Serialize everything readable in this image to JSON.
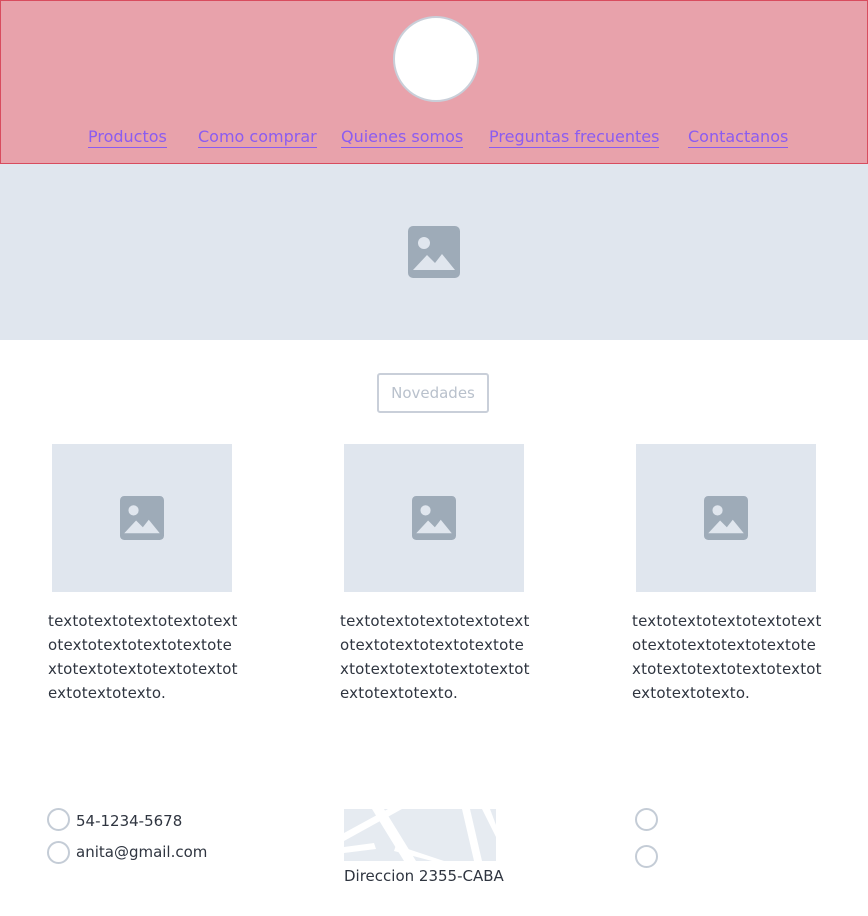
{
  "header": {
    "nav": [
      {
        "label": "Productos"
      },
      {
        "label": "Como comprar"
      },
      {
        "label": "Quienes somos"
      },
      {
        "label": "Preguntas frecuentes"
      },
      {
        "label": "Contactanos"
      }
    ]
  },
  "main": {
    "section_button": "Novedades",
    "cards": [
      {
        "text": "textotextotextotextotextotextotextotextotextotextotextotextotextotextotextotextotexto."
      },
      {
        "text": "textotextotextotextotextotextotextotextotextotextotextotextotextotextotextotextotexto."
      },
      {
        "text": "textotextotextotextotextotextotextotextotextotextotextotextotextotextotextotextotexto."
      }
    ]
  },
  "footer": {
    "phone": "54-1234-5678",
    "email": "anita@gmail.com",
    "address": "Direccion 2355-CABA"
  },
  "colors": {
    "header_bg": "#e8a2ab",
    "header_border": "#d84c5e",
    "link": "#8b5cf0",
    "placeholder_bg": "#e0e6ee",
    "placeholder_icon": "#9eabb8"
  }
}
